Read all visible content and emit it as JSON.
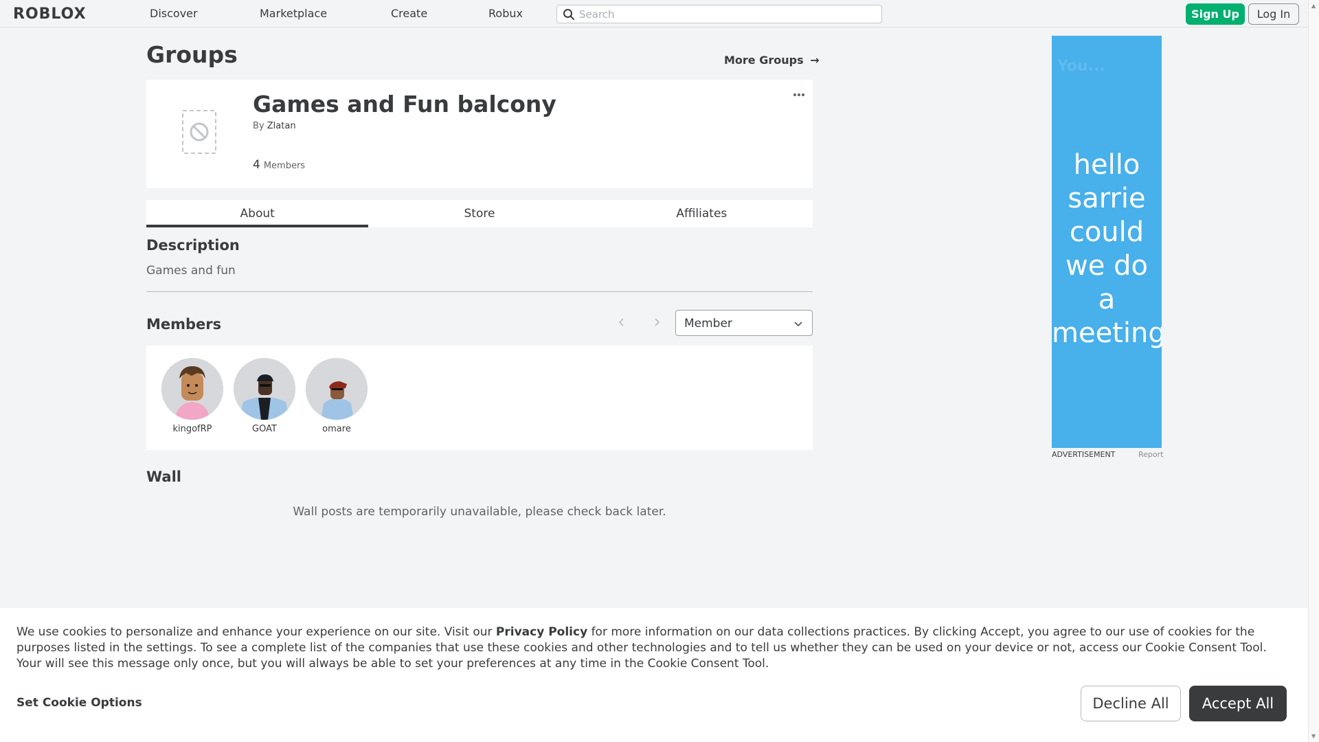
{
  "nav": {
    "logo": "ROBLOX",
    "links": [
      "Discover",
      "Marketplace",
      "Create",
      "Robux"
    ],
    "search_placeholder": "Search",
    "signup_label": "Sign Up",
    "login_label": "Log In"
  },
  "page": {
    "title": "Groups",
    "more_groups": "More Groups"
  },
  "group": {
    "name": "Games and Fun balcony",
    "by_label": "By",
    "owner": "Zlatan",
    "member_count": "4",
    "members_label": "Members"
  },
  "tabs": [
    {
      "label": "About",
      "active": true
    },
    {
      "label": "Store",
      "active": false
    },
    {
      "label": "Affiliates",
      "active": false
    }
  ],
  "description": {
    "heading": "Description",
    "text": "Games and fun"
  },
  "members": {
    "heading": "Members",
    "role_selected": "Member",
    "list": [
      {
        "name": "kingofRP"
      },
      {
        "name": "GOAT"
      },
      {
        "name": "omare"
      }
    ]
  },
  "wall": {
    "heading": "Wall",
    "message": "Wall posts are temporarily unavailable, please check back later."
  },
  "ad": {
    "faint_text": "You...",
    "text_lines": [
      "hello",
      "sarrie",
      "could",
      "we do",
      "a",
      "meeting"
    ],
    "label": "ADVERTISEMENT",
    "report": "Report",
    "color": "#48b0ea"
  },
  "cookie": {
    "text_before": "We use cookies to personalize and enhance your experience on our site. Visit our ",
    "privacy_link": "Privacy Policy",
    "text_after": " for more information on our data collections practices. By clicking Accept, you agree to our use of cookies for the purposes listed in the settings. To see a complete list of the companies that use these cookies and other technologies and to tell us whether they can be used on your device or not, access our Cookie Consent Tool. Your will see this message only once, but you will always be able to set your preferences at any time in the Cookie Consent Tool.",
    "set_options": "Set Cookie Options",
    "decline": "Decline All",
    "accept": "Accept All"
  },
  "colors": {
    "signup_green": "#00b06f",
    "dark": "#393b3d",
    "background": "#f2f4f5"
  }
}
